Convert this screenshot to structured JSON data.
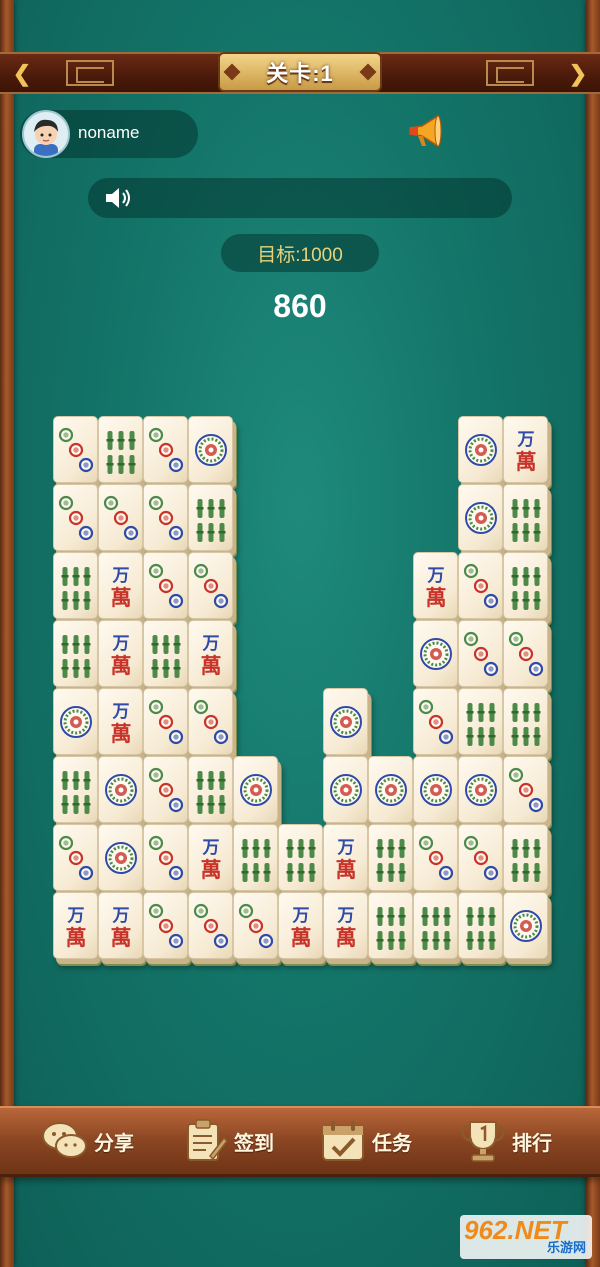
{
  "header": {
    "level_label": "关卡:1",
    "prev_icon": "chevron-left-icon",
    "next_icon": "chevron-right-icon"
  },
  "user": {
    "name": "noname",
    "avatar_icon": "boy-avatar-icon",
    "announce_icon": "megaphone-icon"
  },
  "music": {
    "icon": "speaker-icon"
  },
  "goal": {
    "target_label": "目标:1000",
    "score": "860"
  },
  "tiles": {
    "character_top": "万",
    "character_bottom": "萬",
    "rows": [
      [
        "dots3",
        "bamboo6",
        "dots3",
        "dots1",
        "",
        "",
        "",
        "",
        "",
        "dots1",
        "wan"
      ],
      [
        "dots3",
        "dots3",
        "dots3",
        "bamboo6",
        "",
        "",
        "",
        "",
        "",
        "dots1",
        "bamboo6"
      ],
      [
        "bamboo6",
        "wan",
        "dots3",
        "dots3",
        "",
        "",
        "",
        "",
        "wan",
        "dots3",
        "bamboo6"
      ],
      [
        "bamboo6",
        "wan",
        "bamboo6",
        "wan",
        "",
        "",
        "",
        "",
        "dots1",
        "dots3",
        "dots3"
      ],
      [
        "dots1",
        "wan",
        "dots3",
        "dots3",
        "",
        "",
        "dots1",
        "",
        "dots3",
        "bamboo6",
        "bamboo6"
      ],
      [
        "bamboo6",
        "dots1",
        "dots3",
        "bamboo6",
        "dots1",
        "",
        "dots1",
        "dots1",
        "dots1",
        "dots1",
        "dots3"
      ],
      [
        "dots3",
        "dots1",
        "dots3",
        "wan",
        "bamboo6",
        "bamboo6",
        "wan",
        "bamboo6",
        "dots3",
        "dots3",
        "bamboo6"
      ],
      [
        "wan",
        "wan",
        "dots3",
        "dots3",
        "dots3",
        "wan",
        "wan",
        "bamboo6",
        "bamboo6",
        "bamboo6",
        "dots1"
      ]
    ]
  },
  "menu": [
    {
      "label": "分享",
      "icon": "chat-bubbles-icon"
    },
    {
      "label": "签到",
      "icon": "clipboard-icon"
    },
    {
      "label": "任务",
      "icon": "calendar-check-icon"
    },
    {
      "label": "排行",
      "icon": "trophy-icon"
    }
  ],
  "watermark": {
    "brand": "962.NET",
    "sub": "乐游网"
  },
  "colors": {
    "felt": "#137468",
    "wood": "#8a4522",
    "gold": "#f1c35a",
    "dot_green": "#4d8a4a",
    "dot_red": "#c8342a",
    "dot_blue": "#2f4aa8"
  }
}
